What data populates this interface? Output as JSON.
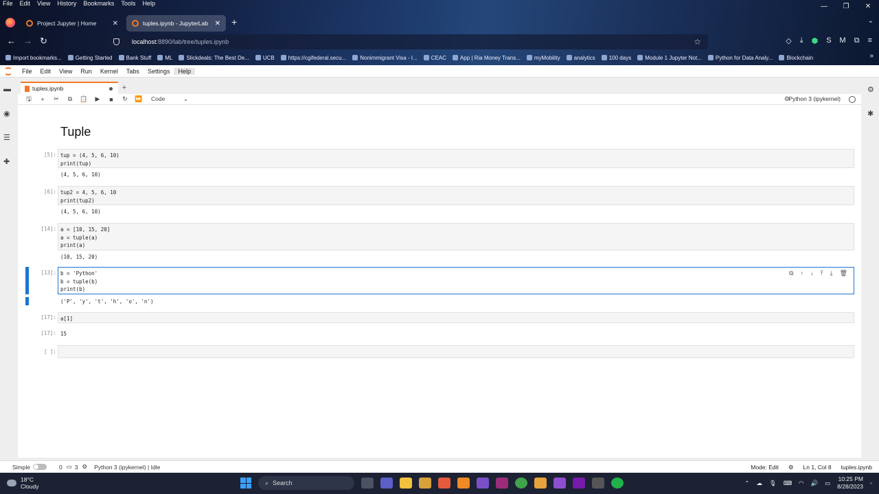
{
  "browser": {
    "menu": [
      "File",
      "Edit",
      "View",
      "History",
      "Bookmarks",
      "Tools",
      "Help"
    ],
    "tabs": [
      {
        "title": "Project Jupyter | Home",
        "active": false
      },
      {
        "title": "tuples.ipynb - JupyterLab",
        "active": true
      }
    ],
    "url_host": "localhost",
    "url_path": ":8890/lab/tree/tuples.ipynb",
    "bookmarks": [
      "Import bookmarks...",
      "Getting Started",
      "Bank Stuff",
      "ML",
      "Slickdeals: The Best De...",
      "UCB",
      "https://cgifederal.secu...",
      "Nonimmigrant Visa - I...",
      "CEAC",
      "App | Ria Money Trans...",
      "myMobility",
      "analytics",
      "100 days",
      "Module 1 Jupyter Not...",
      "Python for Data Analy...",
      "Blockchain"
    ]
  },
  "jupyter": {
    "menu": [
      "File",
      "Edit",
      "View",
      "Run",
      "Kernel",
      "Tabs",
      "Settings",
      "Help"
    ],
    "doc_tab": "tuples.ipynb",
    "cell_type": "Code",
    "kernel": "Python 3 (ipykernel)",
    "title": "Tuple",
    "cells": [
      {
        "prompt": "[5]:",
        "lines": [
          "tup = (4, 5, 6, 10)",
          "print(tup)"
        ],
        "output": "(4, 5, 6, 10)"
      },
      {
        "prompt": "[6]:",
        "lines": [
          "tup2 = 4, 5, 6, 10",
          "print(tup2)"
        ],
        "output": "(4, 5, 6, 10)"
      },
      {
        "prompt": "[14]:",
        "lines": [
          "a = [10, 15, 20]",
          "a = tuple(a)",
          "print(a)"
        ],
        "output": "(10, 15, 20)"
      },
      {
        "prompt": "[13]:",
        "lines": [
          "b = 'Python'",
          "b = tuple(b)",
          "print(b)"
        ],
        "output": "('P', 'y', 't', 'h', 'o', 'n')"
      },
      {
        "prompt": "[17]:",
        "lines": [
          "a[1]"
        ],
        "output_prompt": "[17]:",
        "output": "15"
      },
      {
        "prompt": "[ ]:",
        "lines": [
          ""
        ],
        "output": ""
      }
    ],
    "status": {
      "mode_label": "Simple",
      "terminals": "0",
      "kernels": "3",
      "kernel_status": "Python 3 (ipykernel) | Idle",
      "mode": "Mode: Edit",
      "position": "Ln 1, Col 8",
      "file": "tuples.ipynb"
    }
  },
  "taskbar": {
    "temp": "18°C",
    "weather": "Cloudy",
    "search": "Search",
    "time": "10:25 PM",
    "date": "8/28/2023"
  }
}
